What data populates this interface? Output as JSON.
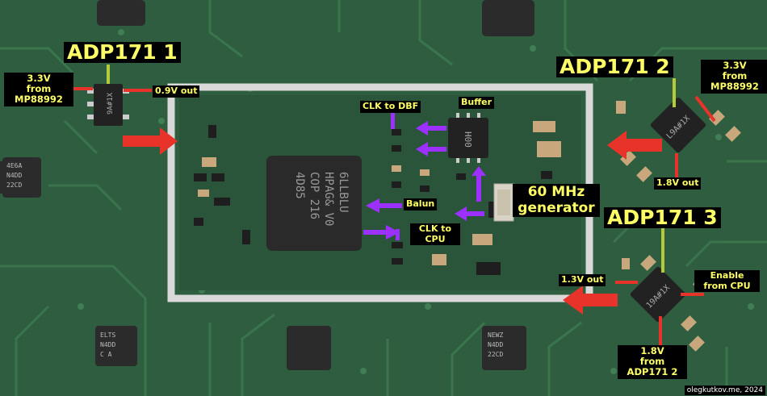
{
  "colors": {
    "pcb_green": "#2e5e3f",
    "label_bg": "#000000",
    "label_text": "#ffff66",
    "arrow_red": "#e8332a",
    "arrow_purple": "#9b30ff",
    "pointer_lime": "#b5c93a",
    "shield_solder": "#d9d9d9"
  },
  "labels": {
    "adp171_1": "ADP171 1",
    "adp171_2": "ADP171 2",
    "adp171_3": "ADP171 3",
    "in_3v3_left": "3.3V\nfrom\nMP88992",
    "in_3v3_right": "3.3V\nfrom\nMP88992",
    "out_0v9": "0.9V out",
    "out_1v8": "1.8V out",
    "out_1v3": "1.3V out",
    "enable_from_cpu": "Enable\nfrom CPU",
    "in_1v8_from_adp171_2": "1.8V\nfrom\nADP171 2",
    "clk_to_dbf": "CLK to DBF",
    "buffer": "Buffer",
    "balun": "Balun",
    "clk_to_cpu": "CLK to\nCPU",
    "generator_60mhz": "60 MHz\ngenerator"
  },
  "chip_markings": {
    "cpu": "6LLBLU\nHPAG& V0\nCOP 216\n4D85",
    "buffer": "H00",
    "adp171_1": "9A#1X",
    "adp171_2": "L9A#1X",
    "adp171_3": "19A#1X",
    "corner_tl": "4E6A\nN4DD\n22CD",
    "corner_bl": "ELTS\nN4DD\nC A",
    "corner_br": "NEWZ\nN4DD\n22CD"
  },
  "watermark": "olegkutkov.me, 2024"
}
